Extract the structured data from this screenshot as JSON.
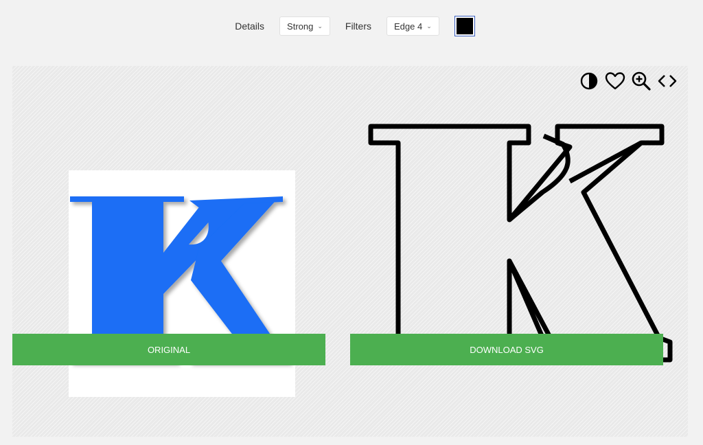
{
  "toolbar": {
    "details_label": "Details",
    "details_value": "Strong",
    "filters_label": "Filters",
    "filters_value": "Edge 4",
    "color_value": "#000000"
  },
  "icons": [
    "contrast-icon",
    "heart-icon",
    "zoom-in-icon",
    "code-icon"
  ],
  "preview": {
    "letter_color": "#1a6ef5",
    "outline_color": "#000000"
  },
  "buttons": {
    "original_label": "ORIGINAL",
    "download_label": "DOWNLOAD SVG",
    "button_color": "#4caf50"
  }
}
